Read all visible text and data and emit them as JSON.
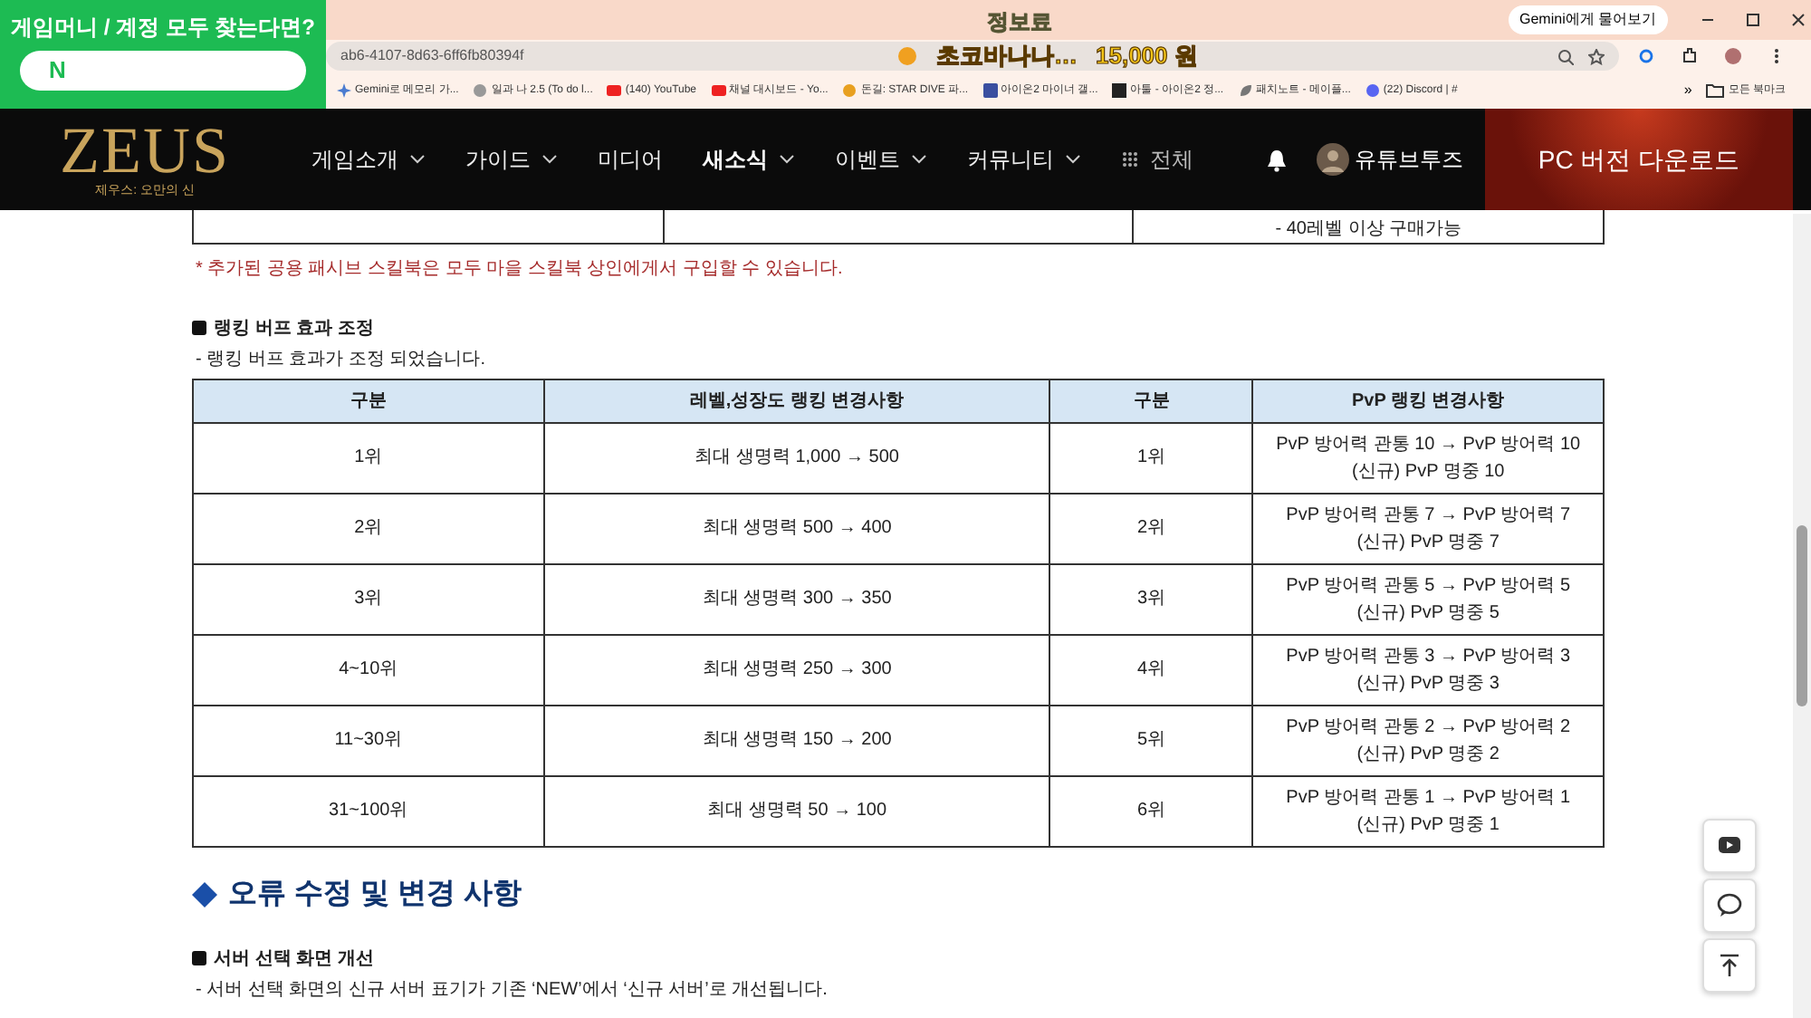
{
  "overlay_banner": {
    "title": "게임머니 / 계정 모두 찾는다면?",
    "field_text": "N"
  },
  "browser": {
    "title": "정보료",
    "donation": {
      "text": "초코바나나…",
      "amount": "15,000 원"
    },
    "ask_button": "Gemini에게 물어보기",
    "address": "ab6-4107-8d63-6ff6fb80394f",
    "bookmarks": [
      {
        "label": "Gemini로 메모리 가..."
      },
      {
        "label": "일과 나 2.5 (To do l..."
      },
      {
        "label": "(140) YouTube"
      },
      {
        "label": "채널 대시보드 - Yo..."
      },
      {
        "label": "돈길: STAR DIVE 파..."
      },
      {
        "label": "아이온2 마이너 갤..."
      },
      {
        "label": "아툴 - 아이온2 정..."
      },
      {
        "label": "패치노트 - 메이플..."
      },
      {
        "label": "(22) Discord | #"
      }
    ],
    "more_bookmarks": "»",
    "all_bookmarks": "모든 북마크"
  },
  "nav": {
    "logo": "ZEUS",
    "logo_subtitle": "제우스: 오만의 신",
    "items": [
      {
        "label": "게임소개",
        "dropdown": true,
        "selected": false
      },
      {
        "label": "가이드",
        "dropdown": true,
        "selected": false
      },
      {
        "label": "미디어",
        "dropdown": false,
        "selected": false
      },
      {
        "label": "새소식",
        "dropdown": true,
        "selected": true
      },
      {
        "label": "이벤트",
        "dropdown": true,
        "selected": false
      },
      {
        "label": "커뮤니티",
        "dropdown": true,
        "selected": false
      }
    ],
    "all_menu": "전체",
    "user": "유튜브투즈",
    "download_button": "PC 버전 다운로드"
  },
  "prev_table_last_row": {
    "column_3": "- 40레벨 이상 구매가능"
  },
  "note": "* 추가된 공용 패시브 스킬북은 모두 마을 스킬북 상인에게서 구입할 수 있습니다.",
  "ranking_section": {
    "title": "랭킹 버프 효과 조정",
    "description": "-  랭킹 버프 효과가 조정 되었습니다.",
    "table": {
      "columns": [
        "구분",
        "레벨,성장도 랭킹 변경사항",
        "구분",
        "PvP 랭킹 변경사항"
      ],
      "rows": [
        [
          "1위",
          "최대 생명력 1,000 → 500",
          "1위",
          "PvP 방어력 관통 10 → PvP 방어력 10\n(신규) PvP 명중 10"
        ],
        [
          "2위",
          "최대 생명력 500 → 400",
          "2위",
          "PvP 방어력 관통 7 → PvP 방어력 7\n(신규) PvP 명중 7"
        ],
        [
          "3위",
          "최대 생명력 300 → 350",
          "3위",
          "PvP 방어력 관통 5 → PvP 방어력 5\n(신규) PvP 명중 5"
        ],
        [
          "4~10위",
          "최대 생명력 250 → 300",
          "4위",
          "PvP 방어력 관통 3 → PvP 방어력 3\n(신규) PvP 명중 3"
        ],
        [
          "11~30위",
          "최대 생명력 150 → 200",
          "5위",
          "PvP 방어력 관통 2 → PvP 방어력 2\n(신규) PvP 명중 2"
        ],
        [
          "31~100위",
          "최대 생명력 50 → 100",
          "6위",
          "PvP 방어력 관통 1 → PvP 방어력 1\n(신규) PvP 명중 1"
        ]
      ]
    }
  },
  "fix_section": {
    "title": "오류 수정 및 변경 사항",
    "items": [
      {
        "title": "서버 선택 화면 개선",
        "description": "- 서버 선택 화면의 신규 서버 표기가 기존 ‘NEW’에서 ‘신규 서버’로 개선됩니다."
      }
    ]
  }
}
